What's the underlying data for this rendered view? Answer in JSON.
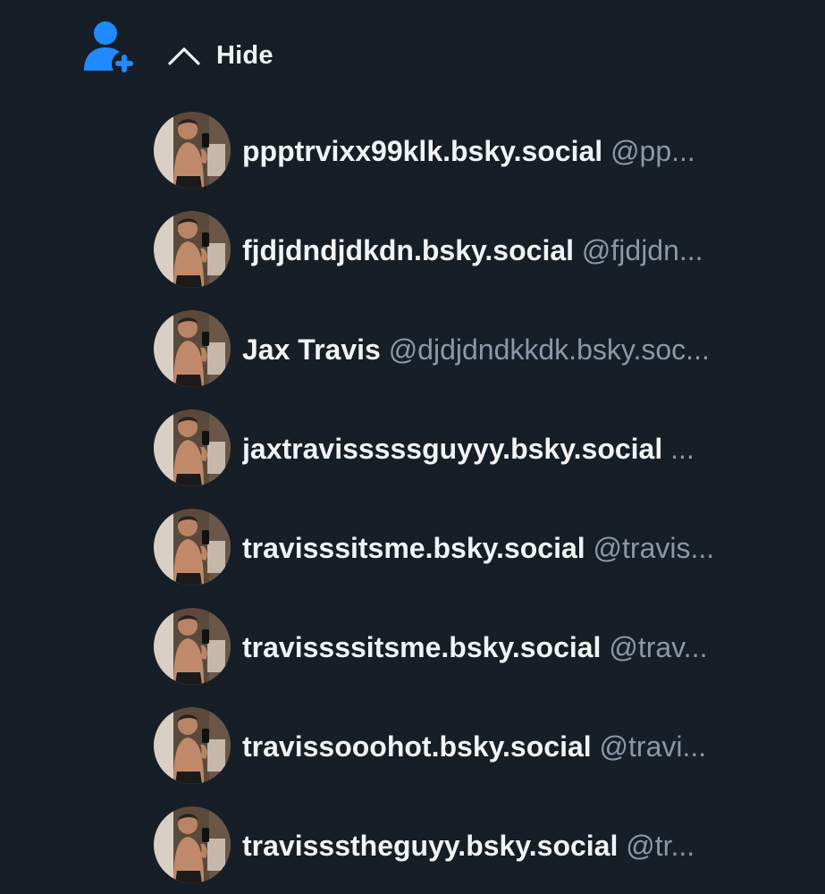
{
  "header": {
    "hide_label": "Hide",
    "follow_icon": "person-plus-icon",
    "chevron_icon": "chevron-up-icon",
    "accent_color": "#208bfe"
  },
  "users": [
    {
      "name": "ppptrvixx99klk.bsky.social",
      "handle": "@pp..."
    },
    {
      "name": "fjdjdndjdkdn.bsky.social",
      "handle": "@fjdjdn..."
    },
    {
      "name": "Jax Travis",
      "handle": "@djdjdndkkdk.bsky.soc..."
    },
    {
      "name": "jaxtravisssssguyyy.bsky.social",
      "handle": "..."
    },
    {
      "name": "travisssitsme.bsky.social",
      "handle": "@travis..."
    },
    {
      "name": "travissssitsme.bsky.social",
      "handle": "@trav..."
    },
    {
      "name": "travissooohot.bsky.social",
      "handle": "@travi..."
    },
    {
      "name": "travissstheguyy.bsky.social",
      "handle": "@tr..."
    }
  ],
  "colors": {
    "background": "#161e27",
    "name_text": "#f1f3f5",
    "handle_text": "#8b98a8"
  }
}
